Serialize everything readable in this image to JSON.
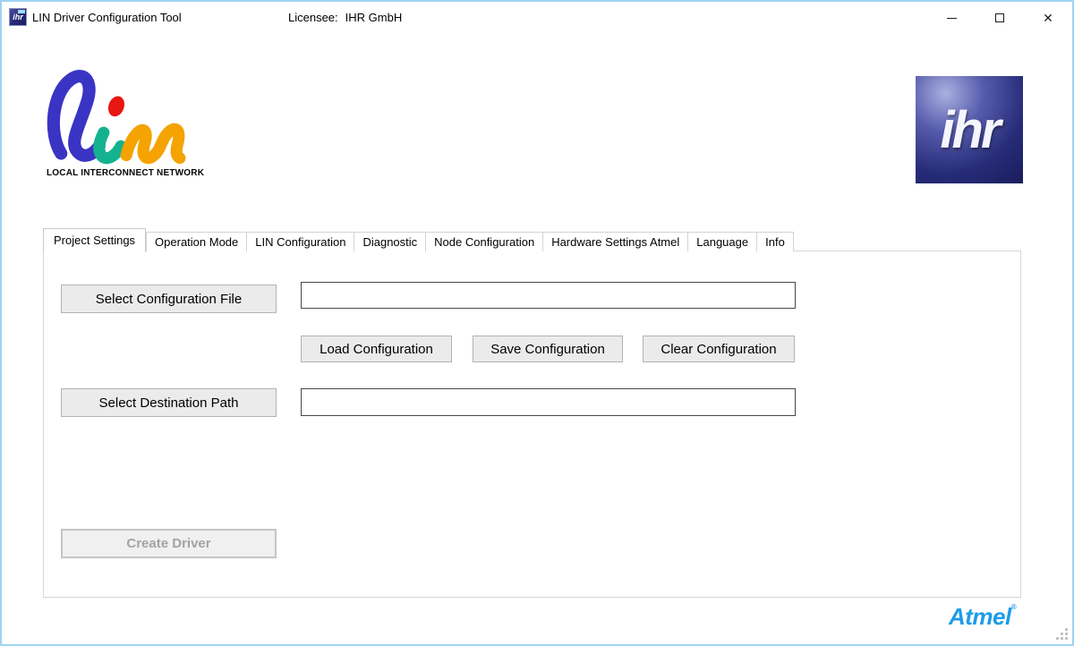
{
  "window": {
    "icon_text": "ihr",
    "title": "LIN Driver Configuration Tool",
    "licensee_label": "Licensee:",
    "licensee_value": "IHR GmbH",
    "close_glyph": "✕"
  },
  "branding": {
    "lin_caption": "LOCAL INTERCONNECT NETWORK",
    "ihr_logo_text": "ihr",
    "atmel_logo_text": "Atmel",
    "atmel_trademark": "®"
  },
  "tabs": [
    {
      "label": "Project Settings",
      "active": true
    },
    {
      "label": "Operation Mode",
      "active": false
    },
    {
      "label": "LIN Configuration",
      "active": false
    },
    {
      "label": "Diagnostic",
      "active": false
    },
    {
      "label": "Node Configuration",
      "active": false
    },
    {
      "label": "Hardware Settings Atmel",
      "active": false
    },
    {
      "label": "Language",
      "active": false
    },
    {
      "label": "Info",
      "active": false
    }
  ],
  "project_settings": {
    "select_configuration_file_button": "Select Configuration File",
    "configuration_file_value": "",
    "load_configuration_button": "Load Configuration",
    "save_configuration_button": "Save Configuration",
    "clear_configuration_button": "Clear Configuration",
    "select_destination_path_button": "Select Destination Path",
    "destination_path_value": "",
    "create_driver_button": "Create Driver",
    "create_driver_enabled": false
  },
  "icons": {
    "minimize": "minimize-icon",
    "maximize": "maximize-icon",
    "close": "close-icon",
    "resize_grip": "resize-grip-icon"
  },
  "colors": {
    "window_border": "#9fd3f2",
    "lin_blue": "#3a34c4",
    "lin_teal": "#15b290",
    "lin_red": "#e81710",
    "lin_orange": "#f4a300",
    "ihr_navy": "#23276f",
    "atmel_blue": "#1c9ce8"
  }
}
